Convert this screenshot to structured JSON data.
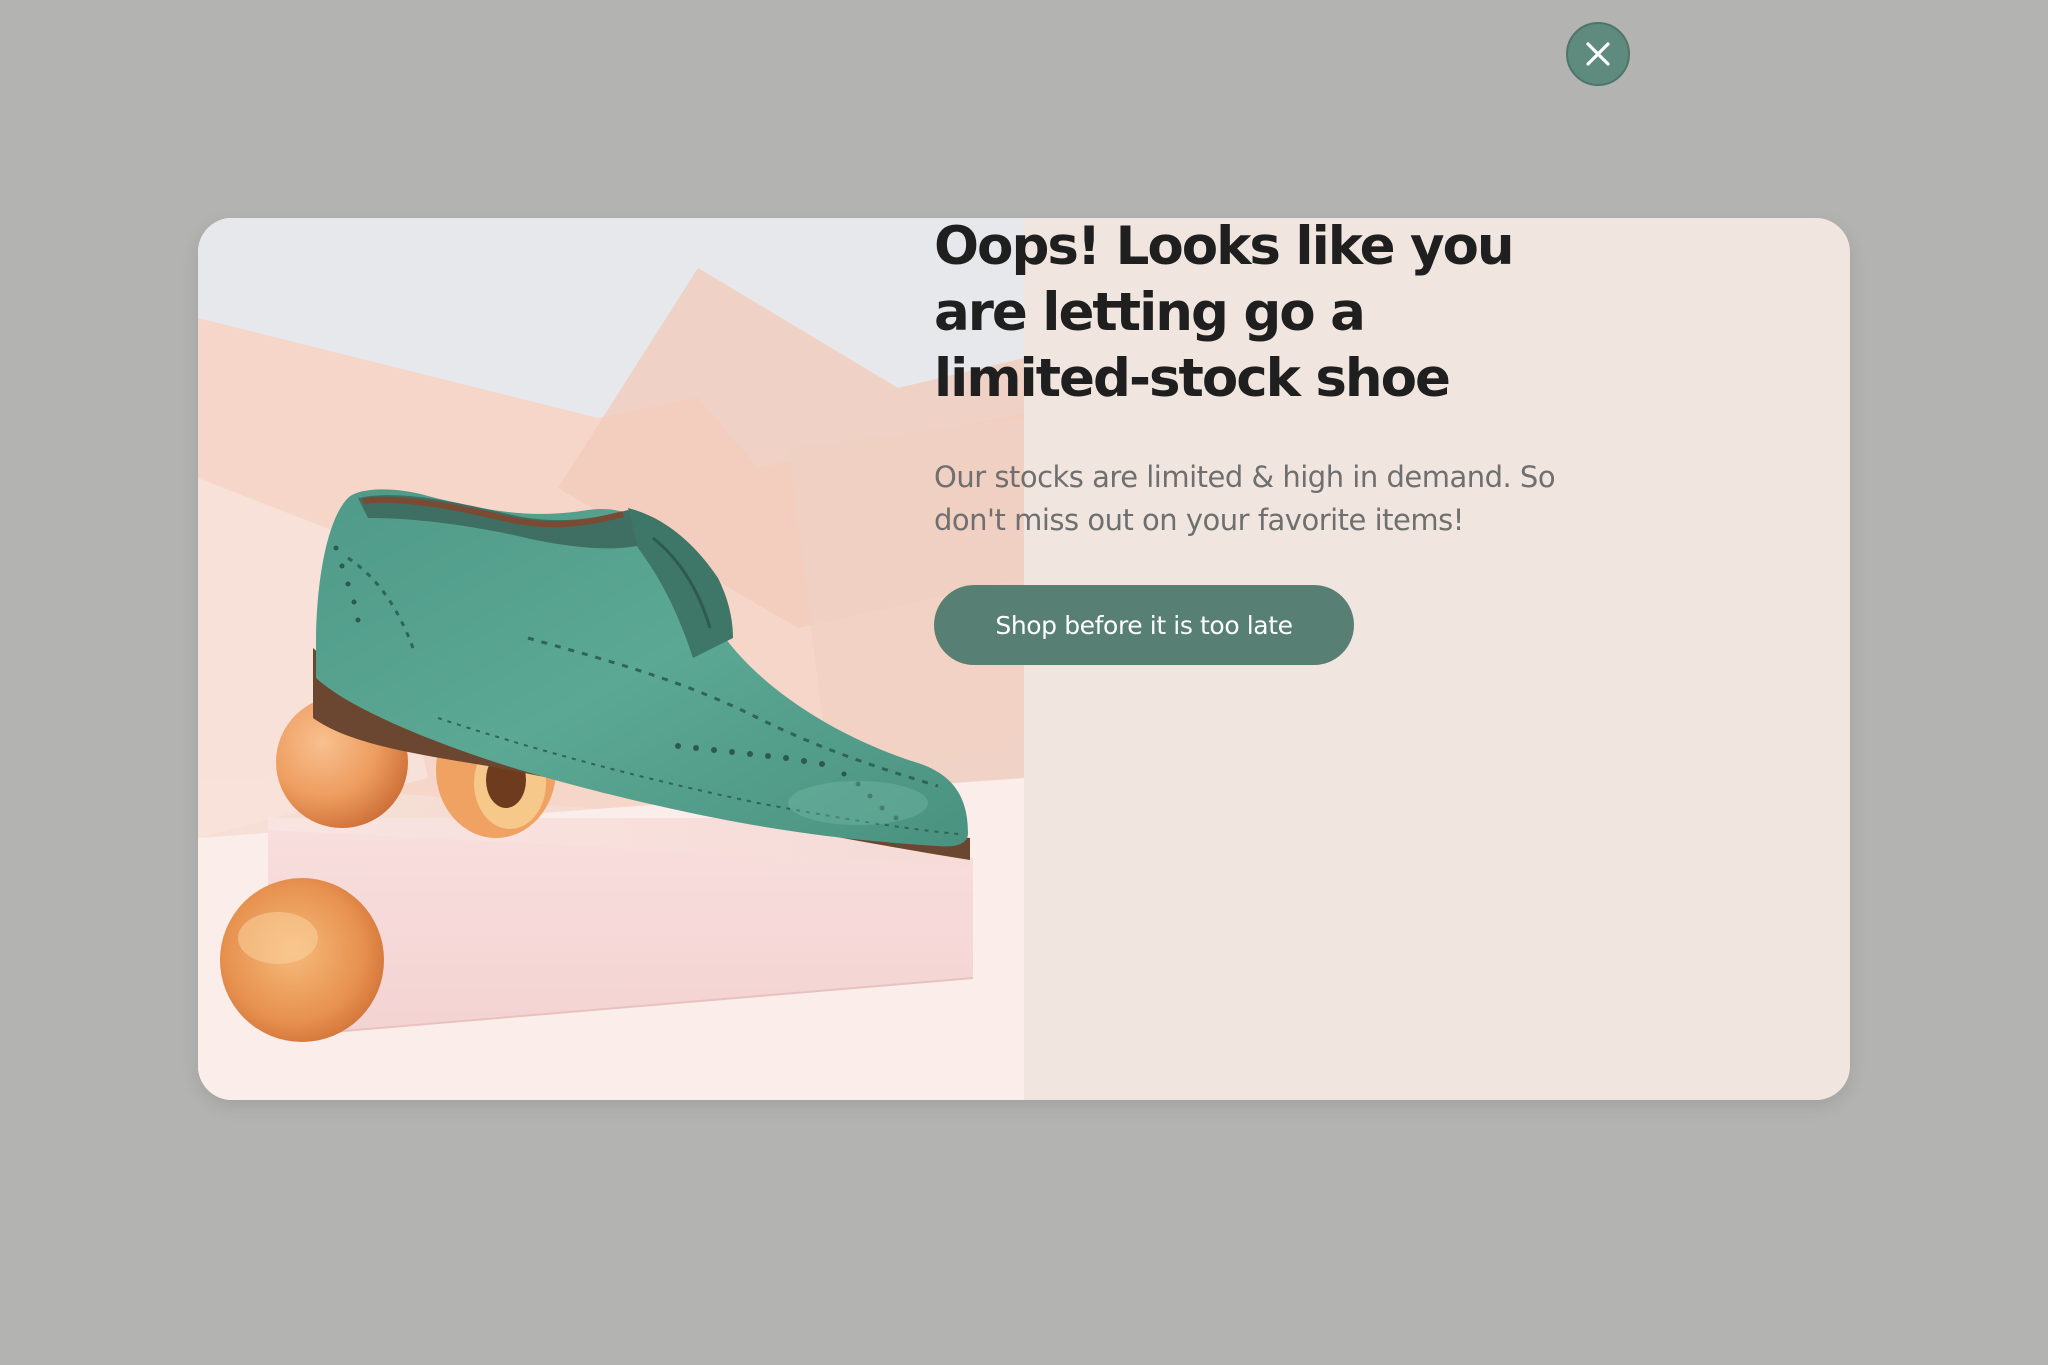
{
  "popup": {
    "headline": "Oops! Looks like you are letting go a limited-stock shoe",
    "subtext": "Our stocks are limited & high in demand. So don't miss out on your favorite items!",
    "cta_label": "Shop before it is too late",
    "close_icon": "close-icon"
  },
  "image": {
    "subject": "teal suede brogue shoe resting on apricots on a pink box"
  },
  "colors": {
    "backdrop": "#b3b3b2",
    "panel": "#f0e6df",
    "accent": "#587f74",
    "headline_text": "#1f1f1f",
    "body_text": "#6f6f6f"
  }
}
